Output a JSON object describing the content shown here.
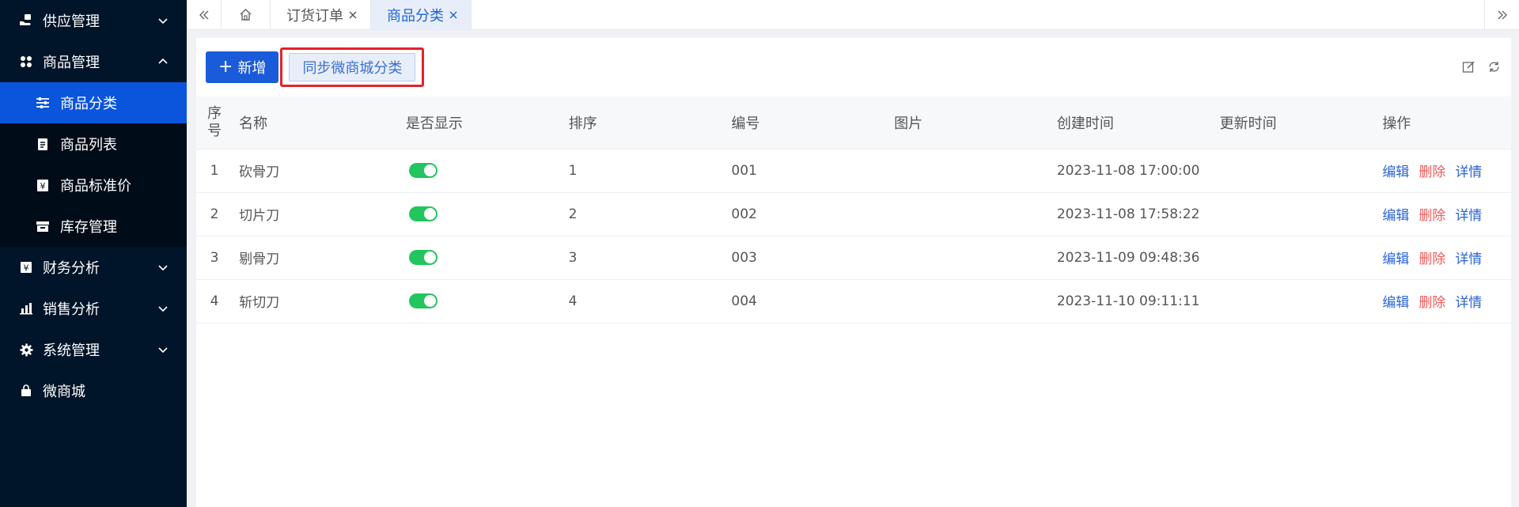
{
  "sidebar": {
    "items": [
      {
        "label": "供应管理",
        "icon": "hand-box-icon",
        "expanded": false
      },
      {
        "label": "商品管理",
        "icon": "grid-icon",
        "expanded": true,
        "children": [
          {
            "label": "商品分类",
            "icon": "sliders-icon",
            "active": true
          },
          {
            "label": "商品列表",
            "icon": "document-icon",
            "active": false
          },
          {
            "label": "商品标准价",
            "icon": "price-icon",
            "active": false
          },
          {
            "label": "库存管理",
            "icon": "warehouse-icon",
            "active": false
          }
        ]
      },
      {
        "label": "财务分析",
        "icon": "yen-icon",
        "expanded": false
      },
      {
        "label": "销售分析",
        "icon": "bar-chart-icon",
        "expanded": false
      },
      {
        "label": "系统管理",
        "icon": "gear-icon",
        "expanded": false
      },
      {
        "label": "微商城",
        "icon": "shopping-bag-icon"
      }
    ]
  },
  "tabs": [
    {
      "label": "订货订单",
      "active": false
    },
    {
      "label": "商品分类",
      "active": true
    }
  ],
  "toolbar": {
    "add_label": "新增",
    "sync_label": "同步微商城分类"
  },
  "table": {
    "columns": {
      "seq_line1": "序",
      "seq_line2": "号",
      "name": "名称",
      "visible": "是否显示",
      "sort": "排序",
      "code": "编号",
      "image": "图片",
      "created": "创建时间",
      "updated": "更新时间",
      "ops": "操作"
    },
    "rows": [
      {
        "seq": "1",
        "name": "砍骨刀",
        "visible": true,
        "sort": "1",
        "code": "001",
        "created": "2023-11-08 17:00:00",
        "updated": ""
      },
      {
        "seq": "2",
        "name": "切片刀",
        "visible": true,
        "sort": "2",
        "code": "002",
        "created": "2023-11-08 17:58:22",
        "updated": ""
      },
      {
        "seq": "3",
        "name": "剔骨刀",
        "visible": true,
        "sort": "3",
        "code": "003",
        "created": "2023-11-09 09:48:36",
        "updated": ""
      },
      {
        "seq": "4",
        "name": "斩切刀",
        "visible": true,
        "sort": "4",
        "code": "004",
        "created": "2023-11-10 09:11:11",
        "updated": ""
      }
    ],
    "ops": {
      "edit": "编辑",
      "delete": "删除",
      "detail": "详情"
    }
  },
  "colors": {
    "sidebar_bg": "#001529",
    "active_menu": "#0a55dc",
    "primary": "#1a5bd9",
    "toggle_on": "#22c55e",
    "danger": "#f25a5a",
    "highlight_border": "#e4222b"
  }
}
